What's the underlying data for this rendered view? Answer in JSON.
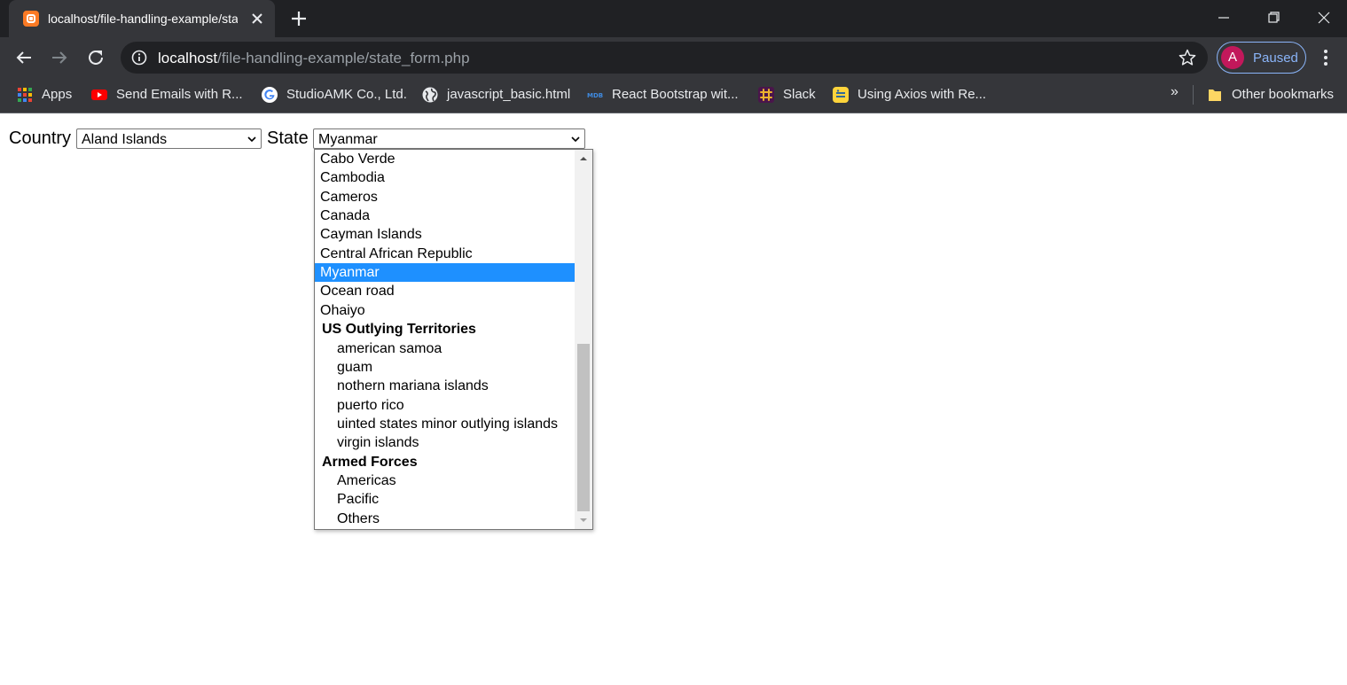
{
  "browser": {
    "tab": {
      "title": "localhost/file-handling-example/state_form.php",
      "favicon": "xampp-icon"
    },
    "address": {
      "host": "localhost",
      "path": "/file-handling-example/state_form.php"
    },
    "profile": {
      "initial": "A",
      "label": "Paused",
      "avatar_color": "#c2185b"
    },
    "bookmarks": [
      {
        "label": "Apps",
        "icon": "apps-grid-icon"
      },
      {
        "label": "Send Emails with R...",
        "icon": "youtube-icon"
      },
      {
        "label": "StudioAMK Co., Ltd.",
        "icon": "google-icon"
      },
      {
        "label": "javascript_basic.html",
        "icon": "globe-icon"
      },
      {
        "label": "React Bootstrap wit...",
        "icon": "mdb-icon"
      },
      {
        "label": "Slack",
        "icon": "slack-icon"
      },
      {
        "label": "Using Axios with Re...",
        "icon": "python-icon"
      }
    ],
    "bookmarks_more": "»",
    "other_bookmarks": "Other bookmarks"
  },
  "form": {
    "country_label": "Country",
    "country_value": "Aland Islands",
    "state_label": "State",
    "state_value": "Myanmar"
  },
  "dropdown": {
    "options": [
      {
        "text": "Cabo Verde",
        "kind": "option"
      },
      {
        "text": "Cambodia",
        "kind": "option"
      },
      {
        "text": "Cameros",
        "kind": "option"
      },
      {
        "text": "Canada",
        "kind": "option"
      },
      {
        "text": "Cayman Islands",
        "kind": "option"
      },
      {
        "text": "Central African Republic",
        "kind": "option"
      },
      {
        "text": "Myanmar",
        "kind": "option",
        "selected": true
      },
      {
        "text": "Ocean road",
        "kind": "option"
      },
      {
        "text": "Ohaiyo",
        "kind": "option"
      },
      {
        "text": "US Outlying Territories",
        "kind": "group"
      },
      {
        "text": "american samoa",
        "kind": "sub"
      },
      {
        "text": "guam",
        "kind": "sub"
      },
      {
        "text": "nothern mariana islands",
        "kind": "sub"
      },
      {
        "text": "puerto rico",
        "kind": "sub"
      },
      {
        "text": "uinted states minor outlying islands",
        "kind": "sub"
      },
      {
        "text": "virgin islands",
        "kind": "sub"
      },
      {
        "text": "Armed Forces",
        "kind": "group"
      },
      {
        "text": "Americas",
        "kind": "sub"
      },
      {
        "text": "Pacific",
        "kind": "sub"
      },
      {
        "text": "Others",
        "kind": "sub"
      }
    ],
    "selected_color": "#1e90ff",
    "scroll_position": 0.51
  }
}
